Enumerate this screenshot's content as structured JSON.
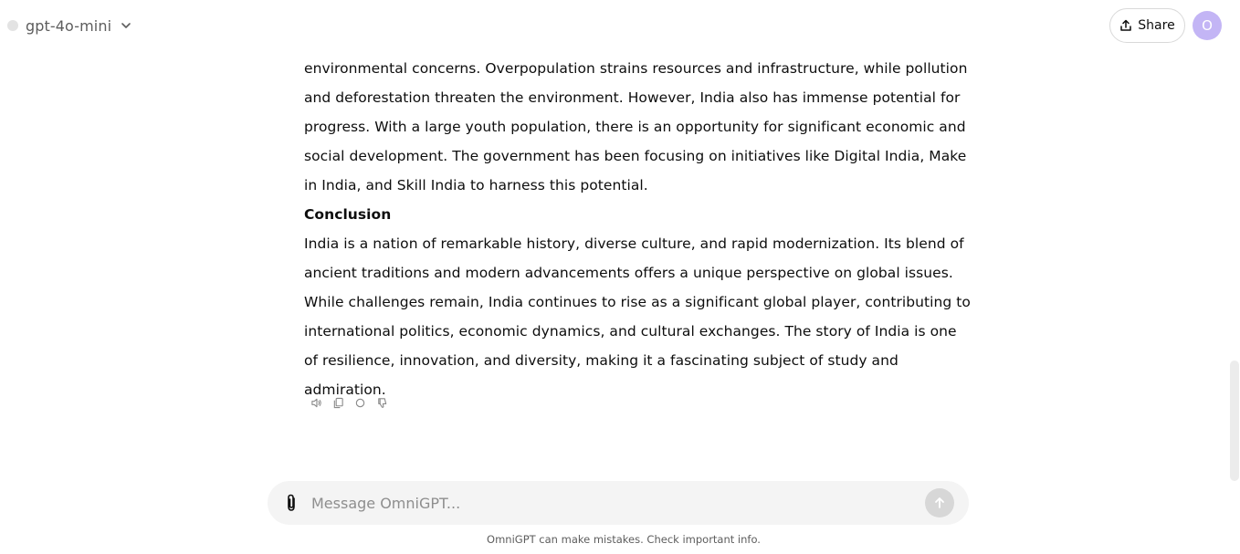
{
  "header": {
    "model_name": "gpt-4o-mini",
    "share_label": "Share",
    "avatar_initial": "O"
  },
  "message": {
    "paragraph_1": "environmental concerns. Overpopulation strains resources and infrastructure, while pollution and deforestation threaten the environment. However, India also has immense potential for progress. With a large youth population, there is an opportunity for significant economic and social development. The government has been focusing on initiatives like Digital India, Make in India, and Skill India to harness this potential.",
    "heading": "Conclusion",
    "paragraph_2": "India is a nation of remarkable history, diverse culture, and rapid modernization. Its blend of ancient traditions and modern advancements offers a unique perspective on global issues. While challenges remain, India continues to rise as a significant global player, contributing to international politics, economic dynamics, and cultural exchanges. The story of India is one of resilience, innovation, and diversity, making it a fascinating subject of study and admiration."
  },
  "actions": [
    "speaker-icon",
    "copy-icon",
    "regenerate-icon",
    "thumbs-down-icon"
  ],
  "composer": {
    "placeholder": "Message OmniGPT..."
  },
  "footer": {
    "disclaimer": "OmniGPT can make mistakes. Check important info."
  },
  "colors": {
    "avatar_bg": "#c3b5f5",
    "composer_bg": "#f4f4f4",
    "send_bg": "#d7d7d7"
  }
}
